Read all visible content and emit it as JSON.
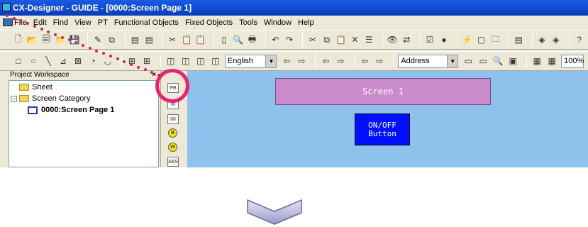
{
  "window": {
    "title": "CX-Designer - GUIDE - [0000:Screen Page 1]"
  },
  "menubar": {
    "items": [
      "File",
      "Edit",
      "Find",
      "View",
      "PT",
      "Functional Objects",
      "Fixed Objects",
      "Tools",
      "Window",
      "Help"
    ]
  },
  "toolbar2": {
    "language_combo": "English",
    "address_combo": "Address",
    "zoom_combo": "100%"
  },
  "workspace": {
    "title": "Project Workspace",
    "close": "×",
    "tree": {
      "sheet": "Sheet",
      "category": "Screen Category",
      "page": "0000:Screen Page 1",
      "expand": "−"
    }
  },
  "palette": {
    "items": [
      "PB",
      "W",
      "IM",
      "B",
      "W",
      "ABS"
    ]
  },
  "canvas": {
    "screen_label": "Screen 1",
    "button_label": "ON/OFF\nButton"
  },
  "colors": {
    "highlight": "#e8236f",
    "canvas_bg": "#8ec1eb",
    "screen_box": "#c98bc9",
    "button_bg": "#0010ff"
  }
}
